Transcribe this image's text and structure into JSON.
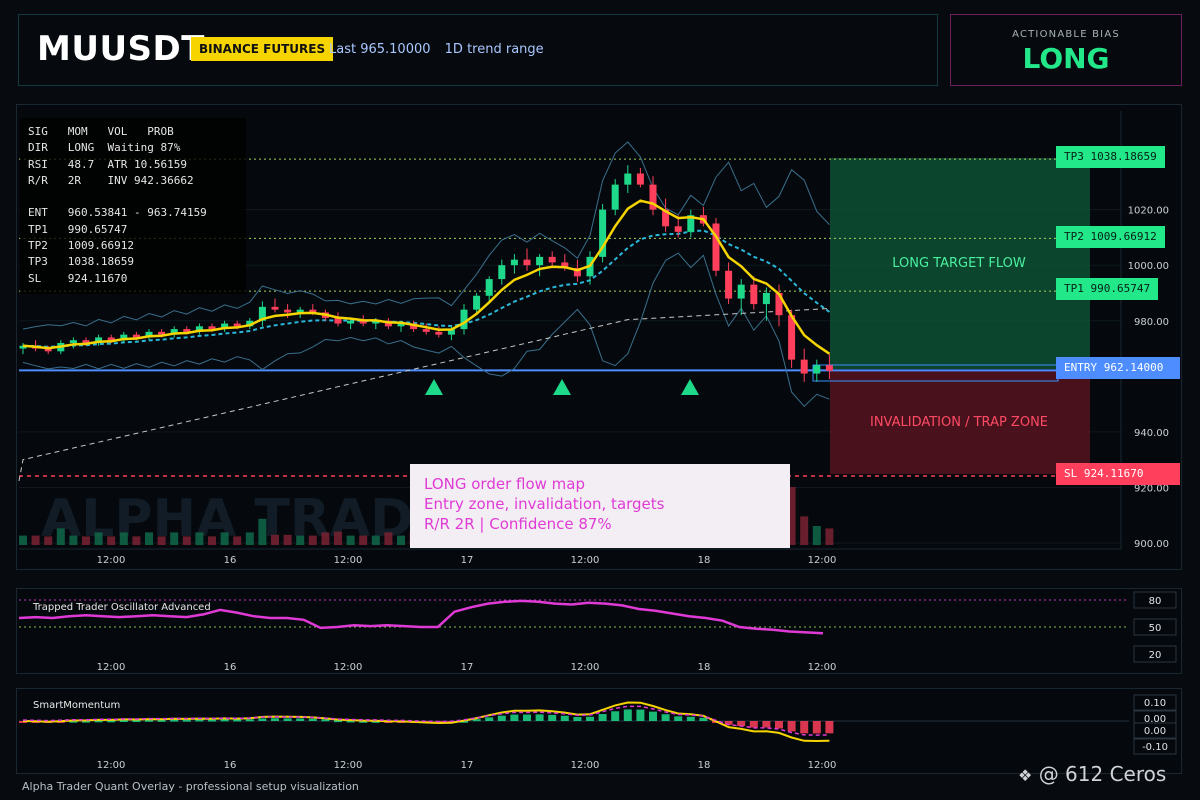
{
  "header": {
    "symbol": "MUUSDT",
    "exchange": "BINANCE FUTURES",
    "last": "Last 965.10000",
    "range": "1D trend range"
  },
  "bias": {
    "label": "ACTIONABLE BIAS",
    "value": "LONG"
  },
  "info_lines": [
    "SIG   MOM   VOL   PROB",
    "DIR   LONG  Waiting 87%",
    "RSI   48.7  ATR 10.56159",
    "R/R   2R    INV 942.36662",
    "",
    "ENT   960.53841 - 963.74159",
    "TP1   990.65747",
    "TP2   1009.66912",
    "TP3   1038.18659",
    "SL    924.11670"
  ],
  "levels": {
    "tp3": "TP3 1038.18659",
    "tp2": "TP2 1009.66912",
    "tp1": "TP1 990.65747",
    "entry": "ENTRY 962.14000",
    "sl": "SL 924.11670"
  },
  "zones": {
    "target": "LONG TARGET FLOW",
    "trap": "INVALIDATION / TRAP ZONE"
  },
  "callout": {
    "line1": "LONG order flow map",
    "line2": "Entry zone, invalidation, targets",
    "line3": "R/R 2R | Confidence 87%"
  },
  "main_axis": [
    "1020.00",
    "1000.00",
    "980.00",
    "940.00",
    "920.00",
    "900.00"
  ],
  "time_axis": [
    "12:00",
    "16",
    "12:00",
    "17",
    "12:00",
    "18",
    "12:00"
  ],
  "watermark_text": "ALPHA TRADER",
  "osc1": {
    "title": "Trapped Trader Oscillator Advanced",
    "axis": [
      "80",
      "50",
      "20"
    ]
  },
  "osc2": {
    "title": "SmartMomentum",
    "axis": [
      "0.10",
      "0.00",
      "0.00",
      "-0.10"
    ]
  },
  "footer": "Alpha Trader Quant Overlay - professional setup visualization",
  "credit": "@ 612 Ceros",
  "colors": {
    "up": "#1fd98a",
    "down": "#ff3f5c",
    "ema": "#f5d400",
    "accent": "#22e88a",
    "magenta": "#e03ad6"
  },
  "chart_data": {
    "type": "candlestick",
    "symbol": "MUUSDT",
    "ylim": [
      897,
      1047
    ],
    "candles_ohlc": [
      [
        970,
        972,
        968,
        971
      ],
      [
        971,
        973,
        969,
        970
      ],
      [
        970,
        971,
        968,
        969
      ],
      [
        969,
        973,
        968,
        972
      ],
      [
        972,
        974,
        970,
        973
      ],
      [
        973,
        974,
        971,
        972
      ],
      [
        972,
        975,
        971,
        974
      ],
      [
        974,
        975,
        972,
        973
      ],
      [
        973,
        976,
        972,
        975
      ],
      [
        975,
        976,
        973,
        974
      ],
      [
        974,
        977,
        973,
        976
      ],
      [
        976,
        977,
        974,
        975
      ],
      [
        975,
        978,
        974,
        977
      ],
      [
        977,
        978,
        975,
        976
      ],
      [
        976,
        979,
        975,
        978
      ],
      [
        978,
        979,
        976,
        977
      ],
      [
        977,
        980,
        976,
        979
      ],
      [
        979,
        980,
        977,
        978
      ],
      [
        978,
        981,
        977,
        980
      ],
      [
        980,
        987,
        978,
        985
      ],
      [
        985,
        988,
        983,
        984
      ],
      [
        984,
        986,
        981,
        983
      ],
      [
        983,
        985,
        981,
        984
      ],
      [
        984,
        986,
        982,
        983
      ],
      [
        983,
        984,
        980,
        981
      ],
      [
        981,
        983,
        978,
        979
      ],
      [
        979,
        981,
        977,
        980
      ],
      [
        980,
        982,
        978,
        979
      ],
      [
        979,
        981,
        977,
        980
      ],
      [
        980,
        981,
        977,
        978
      ],
      [
        978,
        980,
        976,
        979
      ],
      [
        979,
        980,
        976,
        977
      ],
      [
        977,
        979,
        975,
        976
      ],
      [
        976,
        978,
        974,
        975
      ],
      [
        975,
        978,
        973,
        977
      ],
      [
        977,
        986,
        975,
        984
      ],
      [
        984,
        990,
        982,
        989
      ],
      [
        989,
        996,
        987,
        995
      ],
      [
        995,
        1002,
        993,
        1000
      ],
      [
        1000,
        1004,
        997,
        1002
      ],
      [
        1002,
        1006,
        998,
        1000
      ],
      [
        1000,
        1004,
        996,
        1003
      ],
      [
        1003,
        1005,
        999,
        1001
      ],
      [
        1001,
        1004,
        998,
        999
      ],
      [
        999,
        1002,
        994,
        996
      ],
      [
        996,
        1005,
        993,
        1003
      ],
      [
        1003,
        1022,
        1001,
        1020
      ],
      [
        1020,
        1031,
        1018,
        1029
      ],
      [
        1029,
        1036,
        1026,
        1033
      ],
      [
        1033,
        1035,
        1028,
        1029
      ],
      [
        1029,
        1032,
        1018,
        1020
      ],
      [
        1020,
        1024,
        1012,
        1014
      ],
      [
        1014,
        1018,
        1010,
        1012
      ],
      [
        1012,
        1020,
        1010,
        1018
      ],
      [
        1018,
        1021,
        1014,
        1015
      ],
      [
        1015,
        1017,
        996,
        998
      ],
      [
        998,
        1001,
        986,
        988
      ],
      [
        988,
        995,
        982,
        993
      ],
      [
        993,
        996,
        984,
        986
      ],
      [
        986,
        992,
        980,
        990
      ],
      [
        990,
        993,
        978,
        982
      ],
      [
        982,
        984,
        963,
        966
      ],
      [
        966,
        970,
        958,
        961
      ],
      [
        961,
        966,
        958,
        964
      ],
      [
        964,
        968,
        959,
        962
      ]
    ],
    "levels": {
      "tp3": 1038.18659,
      "tp2": 1009.66912,
      "tp1": 990.65747,
      "entry": 962.14,
      "sl": 924.1167
    },
    "oscillator_1": [
      60,
      61,
      60,
      62,
      63,
      62,
      61,
      62,
      63,
      62,
      61,
      64,
      69,
      66,
      62,
      60,
      60,
      58,
      49,
      50,
      52,
      51,
      52,
      51,
      50,
      50,
      67,
      72,
      76,
      78,
      79,
      78,
      76,
      75,
      77,
      76,
      74,
      70,
      68,
      65,
      62,
      60,
      57,
      50,
      48,
      47,
      45,
      44,
      43
    ]
  }
}
